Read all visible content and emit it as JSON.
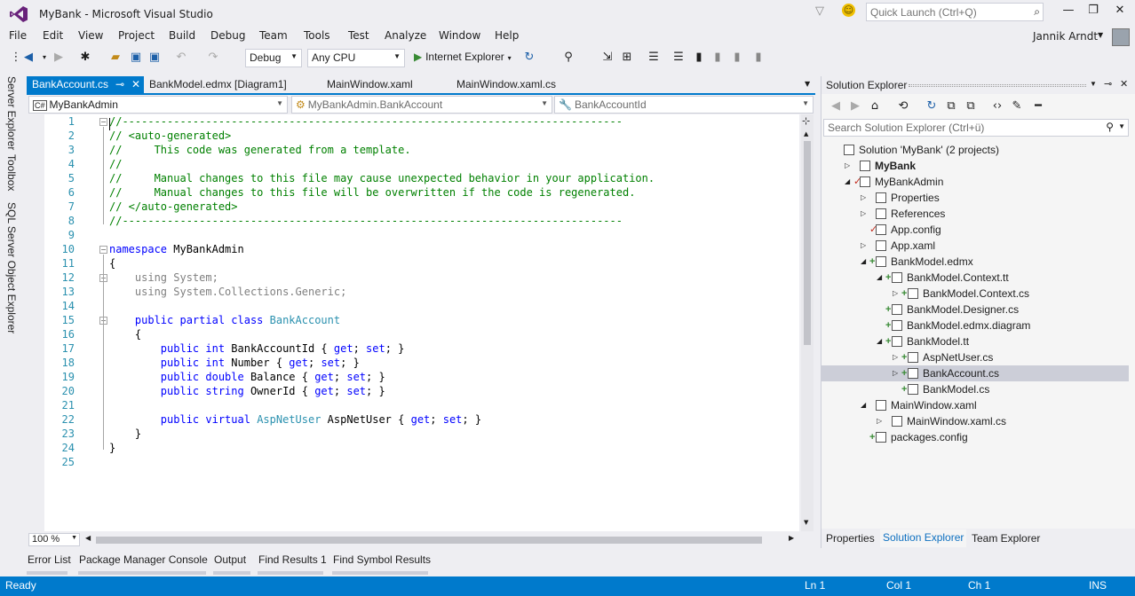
{
  "window": {
    "title": "MyBank - Microsoft Visual Studio",
    "quick_launch_placeholder": "Quick Launch (Ctrl+Q)"
  },
  "menu": [
    "File",
    "Edit",
    "View",
    "Project",
    "Build",
    "Debug",
    "Team",
    "Tools",
    "Test",
    "Analyze",
    "Window",
    "Help"
  ],
  "user": {
    "name": "Jannik Arndt"
  },
  "toolbar": {
    "config": "Debug",
    "platform": "Any CPU",
    "run_label": "Internet Explorer"
  },
  "left_strip": [
    "Server Explorer",
    "Toolbox",
    "SQL Server Object Explorer"
  ],
  "tabs": [
    {
      "label": "BankAccount.cs",
      "active": true
    },
    {
      "label": "BankModel.edmx [Diagram1]",
      "active": false
    },
    {
      "label": "MainWindow.xaml",
      "active": false
    },
    {
      "label": "MainWindow.xaml.cs",
      "active": false
    }
  ],
  "nav": {
    "project": "MyBankAdmin",
    "type": "MyBankAdmin.BankAccount",
    "member": "BankAccountId"
  },
  "editor": {
    "zoom": "100 %",
    "lines": [
      {
        "n": "1",
        "segs": [
          {
            "c": "c-com",
            "t": "//------------------------------------------------------------------------------"
          }
        ]
      },
      {
        "n": "2",
        "segs": [
          {
            "c": "c-com",
            "t": "// <auto-generated>"
          }
        ]
      },
      {
        "n": "3",
        "segs": [
          {
            "c": "c-com",
            "t": "//     This code was generated from a template."
          }
        ]
      },
      {
        "n": "4",
        "segs": [
          {
            "c": "c-com",
            "t": "//"
          }
        ]
      },
      {
        "n": "5",
        "segs": [
          {
            "c": "c-com",
            "t": "//     Manual changes to this file may cause unexpected behavior in your application."
          }
        ]
      },
      {
        "n": "6",
        "segs": [
          {
            "c": "c-com",
            "t": "//     Manual changes to this file will be overwritten if the code is regenerated."
          }
        ]
      },
      {
        "n": "7",
        "segs": [
          {
            "c": "c-com",
            "t": "// </auto-generated>"
          }
        ]
      },
      {
        "n": "8",
        "segs": [
          {
            "c": "c-com",
            "t": "//------------------------------------------------------------------------------"
          }
        ]
      },
      {
        "n": "9",
        "segs": []
      },
      {
        "n": "10",
        "segs": [
          {
            "c": "c-kw",
            "t": "namespace"
          },
          {
            "c": "",
            "t": " MyBankAdmin"
          }
        ]
      },
      {
        "n": "11",
        "segs": [
          {
            "c": "",
            "t": "{"
          }
        ]
      },
      {
        "n": "12",
        "segs": [
          {
            "c": "c-gray",
            "t": "    using System;"
          }
        ]
      },
      {
        "n": "13",
        "segs": [
          {
            "c": "c-gray",
            "t": "    using System.Collections.Generic;"
          }
        ]
      },
      {
        "n": "14",
        "segs": []
      },
      {
        "n": "15",
        "segs": [
          {
            "c": "c-kw",
            "t": "    public partial class"
          },
          {
            "c": "",
            "t": " "
          },
          {
            "c": "c-typ",
            "t": "BankAccount"
          }
        ]
      },
      {
        "n": "16",
        "segs": [
          {
            "c": "",
            "t": "    {"
          }
        ]
      },
      {
        "n": "17",
        "segs": [
          {
            "c": "c-kw",
            "t": "        public int"
          },
          {
            "c": "",
            "t": " BankAccountId { "
          },
          {
            "c": "c-kw",
            "t": "get"
          },
          {
            "c": "",
            "t": "; "
          },
          {
            "c": "c-kw",
            "t": "set"
          },
          {
            "c": "",
            "t": "; }"
          }
        ]
      },
      {
        "n": "18",
        "segs": [
          {
            "c": "c-kw",
            "t": "        public int"
          },
          {
            "c": "",
            "t": " Number { "
          },
          {
            "c": "c-kw",
            "t": "get"
          },
          {
            "c": "",
            "t": "; "
          },
          {
            "c": "c-kw",
            "t": "set"
          },
          {
            "c": "",
            "t": "; }"
          }
        ]
      },
      {
        "n": "19",
        "segs": [
          {
            "c": "c-kw",
            "t": "        public double"
          },
          {
            "c": "",
            "t": " Balance { "
          },
          {
            "c": "c-kw",
            "t": "get"
          },
          {
            "c": "",
            "t": "; "
          },
          {
            "c": "c-kw",
            "t": "set"
          },
          {
            "c": "",
            "t": "; }"
          }
        ]
      },
      {
        "n": "20",
        "segs": [
          {
            "c": "c-kw",
            "t": "        public string"
          },
          {
            "c": "",
            "t": " OwnerId { "
          },
          {
            "c": "c-kw",
            "t": "get"
          },
          {
            "c": "",
            "t": "; "
          },
          {
            "c": "c-kw",
            "t": "set"
          },
          {
            "c": "",
            "t": "; }"
          }
        ]
      },
      {
        "n": "21",
        "segs": []
      },
      {
        "n": "22",
        "segs": [
          {
            "c": "c-kw",
            "t": "        public virtual"
          },
          {
            "c": "",
            "t": " "
          },
          {
            "c": "c-typ",
            "t": "AspNetUser"
          },
          {
            "c": "",
            "t": " AspNetUser { "
          },
          {
            "c": "c-kw",
            "t": "get"
          },
          {
            "c": "",
            "t": "; "
          },
          {
            "c": "c-kw",
            "t": "set"
          },
          {
            "c": "",
            "t": "; }"
          }
        ]
      },
      {
        "n": "23",
        "segs": [
          {
            "c": "",
            "t": "    }"
          }
        ]
      },
      {
        "n": "24",
        "segs": [
          {
            "c": "",
            "t": "}"
          }
        ]
      },
      {
        "n": "25",
        "segs": []
      }
    ]
  },
  "solution_explorer": {
    "title": "Solution Explorer",
    "search_placeholder": "Search Solution Explorer (Ctrl+ü)",
    "items": [
      {
        "label": "Solution 'MyBank' (2 projects)",
        "depth": 0,
        "exp": "",
        "bold": false,
        "mark": ""
      },
      {
        "label": "MyBank",
        "depth": 1,
        "exp": "▷",
        "bold": true,
        "mark": ""
      },
      {
        "label": "MyBankAdmin",
        "depth": 1,
        "exp": "◢",
        "bold": false,
        "mark": "✓"
      },
      {
        "label": "Properties",
        "depth": 2,
        "exp": "▷",
        "bold": false,
        "mark": ""
      },
      {
        "label": "References",
        "depth": 2,
        "exp": "▷",
        "bold": false,
        "mark": ""
      },
      {
        "label": "App.config",
        "depth": 2,
        "exp": "",
        "bold": false,
        "mark": "✓"
      },
      {
        "label": "App.xaml",
        "depth": 2,
        "exp": "▷",
        "bold": false,
        "mark": ""
      },
      {
        "label": "BankModel.edmx",
        "depth": 2,
        "exp": "◢",
        "bold": false,
        "mark": "+"
      },
      {
        "label": "BankModel.Context.tt",
        "depth": 3,
        "exp": "◢",
        "bold": false,
        "mark": "+"
      },
      {
        "label": "BankModel.Context.cs",
        "depth": 4,
        "exp": "▷",
        "bold": false,
        "mark": "+"
      },
      {
        "label": "BankModel.Designer.cs",
        "depth": 3,
        "exp": "",
        "bold": false,
        "mark": "+"
      },
      {
        "label": "BankModel.edmx.diagram",
        "depth": 3,
        "exp": "",
        "bold": false,
        "mark": "+"
      },
      {
        "label": "BankModel.tt",
        "depth": 3,
        "exp": "◢",
        "bold": false,
        "mark": "+"
      },
      {
        "label": "AspNetUser.cs",
        "depth": 4,
        "exp": "▷",
        "bold": false,
        "mark": "+"
      },
      {
        "label": "BankAccount.cs",
        "depth": 4,
        "exp": "▷",
        "bold": false,
        "mark": "+",
        "selected": true
      },
      {
        "label": "BankModel.cs",
        "depth": 4,
        "exp": "",
        "bold": false,
        "mark": "+"
      },
      {
        "label": "MainWindow.xaml",
        "depth": 2,
        "exp": "◢",
        "bold": false,
        "mark": ""
      },
      {
        "label": "MainWindow.xaml.cs",
        "depth": 3,
        "exp": "▷",
        "bold": false,
        "mark": ""
      },
      {
        "label": "packages.config",
        "depth": 2,
        "exp": "",
        "bold": false,
        "mark": "+"
      }
    ],
    "bottom_tabs": [
      "Properties",
      "Solution Explorer",
      "Team Explorer"
    ]
  },
  "output_tabs": [
    "Error List",
    "Package Manager Console",
    "Output",
    "Find Results 1",
    "Find Symbol Results"
  ],
  "status": {
    "state": "Ready",
    "ln": "Ln 1",
    "col": "Col 1",
    "ch": "Ch 1",
    "mode": "INS"
  },
  "colors": {
    "accent": "#007acc",
    "comment": "#008000",
    "keyword": "#0000ff",
    "type": "#2b91af"
  }
}
